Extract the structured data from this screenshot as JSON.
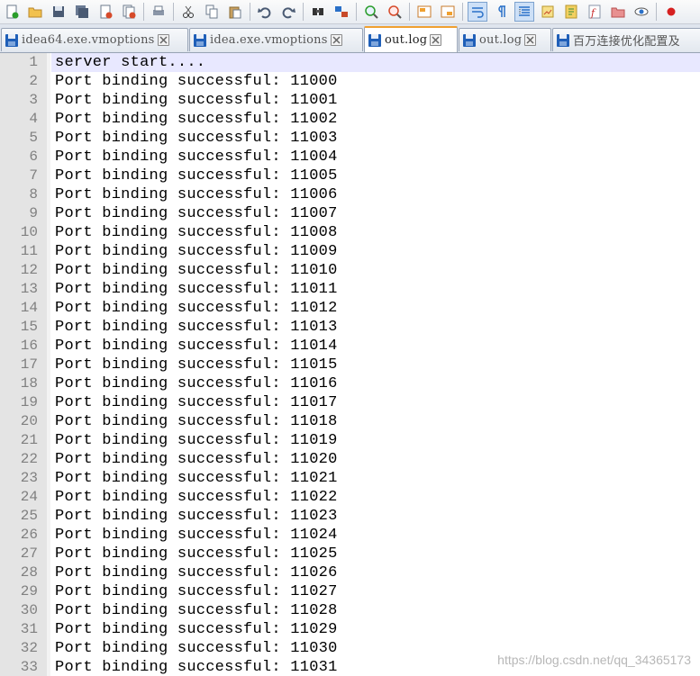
{
  "toolbar": {
    "icons": [
      "new-file-icon",
      "open-folder-icon",
      "save-icon",
      "save-all-icon",
      "close-icon",
      "close-all-icon",
      "print-icon",
      "cut-icon",
      "copy-icon",
      "paste-icon",
      "undo-icon",
      "redo-icon",
      "find-icon",
      "replace-icon",
      "zoom-in-icon",
      "zoom-out-icon",
      "sync-vertical-icon",
      "sync-horizontal-icon",
      "word-wrap-icon",
      "show-all-chars-icon",
      "indent-guide-icon",
      "user-lang-icon",
      "doc-map-icon",
      "function-list-icon",
      "folder-workspace-icon",
      "monitor-icon",
      "record-macro-icon"
    ]
  },
  "tabs": [
    {
      "label": "idea64.exe.vmoptions",
      "active": false
    },
    {
      "label": "idea.exe.vmoptions",
      "active": false
    },
    {
      "label": "out.log",
      "active": true
    },
    {
      "label": "out.log",
      "active": false
    },
    {
      "label": "百万连接优化配置及",
      "active": false
    }
  ],
  "editor": {
    "lines": [
      {
        "n": "1",
        "text": "server start...."
      },
      {
        "n": "2",
        "text": "Port binding successful: 11000"
      },
      {
        "n": "3",
        "text": "Port binding successful: 11001"
      },
      {
        "n": "4",
        "text": "Port binding successful: 11002"
      },
      {
        "n": "5",
        "text": "Port binding successful: 11003"
      },
      {
        "n": "6",
        "text": "Port binding successful: 11004"
      },
      {
        "n": "7",
        "text": "Port binding successful: 11005"
      },
      {
        "n": "8",
        "text": "Port binding successful: 11006"
      },
      {
        "n": "9",
        "text": "Port binding successful: 11007"
      },
      {
        "n": "10",
        "text": "Port binding successful: 11008"
      },
      {
        "n": "11",
        "text": "Port binding successful: 11009"
      },
      {
        "n": "12",
        "text": "Port binding successful: 11010"
      },
      {
        "n": "13",
        "text": "Port binding successful: 11011"
      },
      {
        "n": "14",
        "text": "Port binding successful: 11012"
      },
      {
        "n": "15",
        "text": "Port binding successful: 11013"
      },
      {
        "n": "16",
        "text": "Port binding successful: 11014"
      },
      {
        "n": "17",
        "text": "Port binding successful: 11015"
      },
      {
        "n": "18",
        "text": "Port binding successful: 11016"
      },
      {
        "n": "19",
        "text": "Port binding successful: 11017"
      },
      {
        "n": "20",
        "text": "Port binding successful: 11018"
      },
      {
        "n": "21",
        "text": "Port binding successful: 11019"
      },
      {
        "n": "22",
        "text": "Port binding successful: 11020"
      },
      {
        "n": "23",
        "text": "Port binding successful: 11021"
      },
      {
        "n": "24",
        "text": "Port binding successful: 11022"
      },
      {
        "n": "25",
        "text": "Port binding successful: 11023"
      },
      {
        "n": "26",
        "text": "Port binding successful: 11024"
      },
      {
        "n": "27",
        "text": "Port binding successful: 11025"
      },
      {
        "n": "28",
        "text": "Port binding successful: 11026"
      },
      {
        "n": "29",
        "text": "Port binding successful: 11027"
      },
      {
        "n": "30",
        "text": "Port binding successful: 11028"
      },
      {
        "n": "31",
        "text": "Port binding successful: 11029"
      },
      {
        "n": "32",
        "text": "Port binding successful: 11030"
      },
      {
        "n": "33",
        "text": "Port binding successful: 11031"
      }
    ]
  },
  "watermark": "https://blog.csdn.net/qq_34365173",
  "colors": {
    "current_line": "#e8e8ff",
    "gutter": "#e4e4e4",
    "line_number": "#808080",
    "active_tab_accent": "#f0a030"
  }
}
